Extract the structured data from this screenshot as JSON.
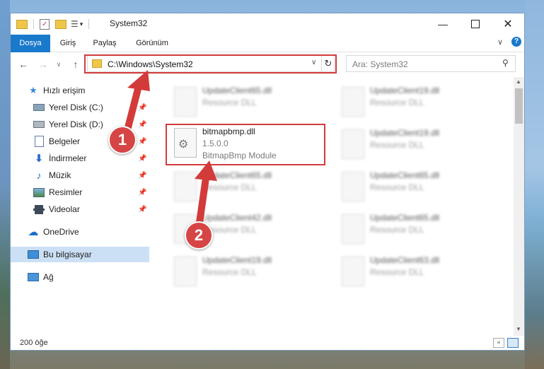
{
  "window": {
    "title": "System32"
  },
  "ribbon": {
    "tabs": [
      "Dosya",
      "Giriş",
      "Paylaş",
      "Görünüm"
    ]
  },
  "address": {
    "path": "C:\\Windows\\System32"
  },
  "search": {
    "placeholder": "Ara: System32"
  },
  "sidebar": {
    "quick_access": "Hızlı erişim",
    "items": [
      {
        "label": "Yerel Disk (C:)",
        "icon": "drive-icon"
      },
      {
        "label": "Yerel Disk (D:)",
        "icon": "drive-icon"
      },
      {
        "label": "Belgeler",
        "icon": "documents-icon"
      },
      {
        "label": "İndirmeler",
        "icon": "download-icon"
      },
      {
        "label": "Müzik",
        "icon": "music-icon"
      },
      {
        "label": "Resimler",
        "icon": "pictures-icon"
      },
      {
        "label": "Videolar",
        "icon": "video-icon"
      }
    ],
    "onedrive": "OneDrive",
    "this_pc": "Bu bilgisayar",
    "network": "Ağ"
  },
  "files": {
    "highlighted": {
      "name": "bitmapbmp.dll",
      "version": "1.5.0.0",
      "description": "BitmapBmp Module"
    },
    "left_column": [
      {
        "name": "UpdateClient65.dll",
        "description": "Resource DLL"
      },
      {
        "name": "UpdateClient65.dll",
        "description": "Resource DLL"
      },
      {
        "name": "UpdateClient42.dll",
        "description": "Resource DLL"
      },
      {
        "name": "UpdateClient19.dll",
        "description": "Resource DLL"
      }
    ],
    "right_column": [
      {
        "name": "UpdateClient19.dll",
        "description": "Resource DLL"
      },
      {
        "name": "UpdateClient19.dll",
        "description": "Resource DLL"
      },
      {
        "name": "UpdateClient65.dll",
        "description": "Resource DLL"
      },
      {
        "name": "UpdateClient65.dll",
        "description": "Resource DLL"
      },
      {
        "name": "UpdateClient63.dll",
        "description": "Resource DLL"
      }
    ]
  },
  "status": {
    "item_count": "200 öğe"
  },
  "annotations": {
    "step1": "1",
    "step2": "2",
    "color": "#d33b3b"
  }
}
